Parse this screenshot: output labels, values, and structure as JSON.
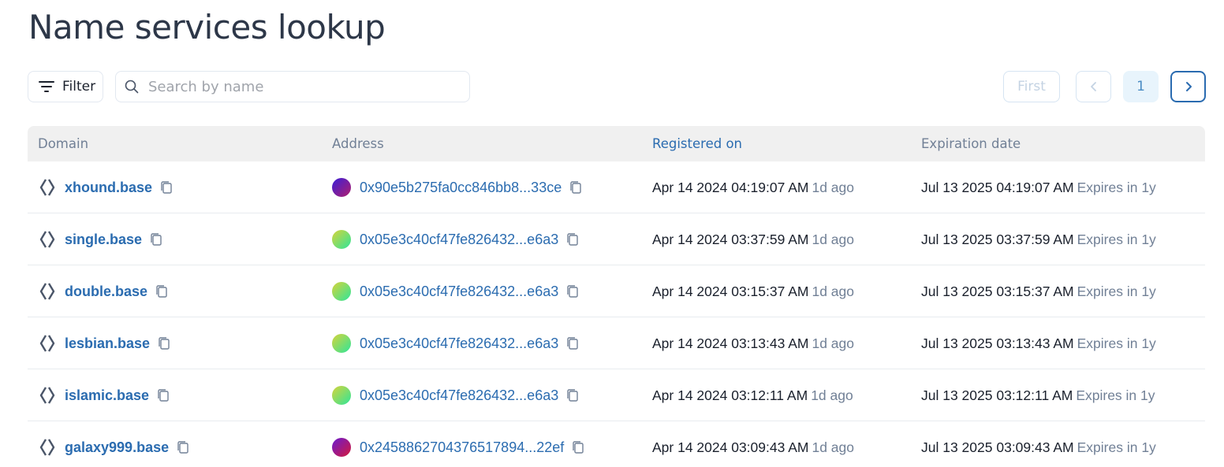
{
  "page": {
    "title": "Name services lookup"
  },
  "toolbar": {
    "filter_label": "Filter",
    "search_placeholder": "Search by name"
  },
  "pagination": {
    "first_label": "First",
    "current_page": "1"
  },
  "table": {
    "headers": {
      "domain": "Domain",
      "address": "Address",
      "registered": "Registered on",
      "expiration": "Expiration date"
    },
    "rows": [
      {
        "domain": "xhound.base",
        "address": "0x90e5b275fa0cc846bb8...33ce",
        "avatar_colors": [
          "#3b1fd8",
          "#b01f6e"
        ],
        "registered": "Apr 14 2024 04:19:07 AM",
        "registered_ago": "1d ago",
        "expires": "Jul 13 2025 04:19:07 AM",
        "expires_in": "Expires in 1y"
      },
      {
        "domain": "single.base",
        "address": "0x05e3c40cf47fe826432...e6a3",
        "avatar_colors": [
          "#d6d43a",
          "#2ee59a"
        ],
        "registered": "Apr 14 2024 03:37:59 AM",
        "registered_ago": "1d ago",
        "expires": "Jul 13 2025 03:37:59 AM",
        "expires_in": "Expires in 1y"
      },
      {
        "domain": "double.base",
        "address": "0x05e3c40cf47fe826432...e6a3",
        "avatar_colors": [
          "#d6d43a",
          "#2ee59a"
        ],
        "registered": "Apr 14 2024 03:15:37 AM",
        "registered_ago": "1d ago",
        "expires": "Jul 13 2025 03:15:37 AM",
        "expires_in": "Expires in 1y"
      },
      {
        "domain": "lesbian.base",
        "address": "0x05e3c40cf47fe826432...e6a3",
        "avatar_colors": [
          "#d6d43a",
          "#2ee59a"
        ],
        "registered": "Apr 14 2024 03:13:43 AM",
        "registered_ago": "1d ago",
        "expires": "Jul 13 2025 03:13:43 AM",
        "expires_in": "Expires in 1y"
      },
      {
        "domain": "islamic.base",
        "address": "0x05e3c40cf47fe826432...e6a3",
        "avatar_colors": [
          "#d6d43a",
          "#2ee59a"
        ],
        "registered": "Apr 14 2024 03:12:11 AM",
        "registered_ago": "1d ago",
        "expires": "Jul 13 2025 03:12:11 AM",
        "expires_in": "Expires in 1y"
      },
      {
        "domain": "galaxy999.base",
        "address": "0x2458862704376517894...22ef",
        "avatar_colors": [
          "#6a1bd1",
          "#d41a3c"
        ],
        "registered": "Apr 14 2024 03:09:43 AM",
        "registered_ago": "1d ago",
        "expires": "Jul 13 2025 03:09:43 AM",
        "expires_in": "Expires in 1y"
      }
    ]
  },
  "colors": {
    "link": "#2b6cb0",
    "muted": "#718096",
    "header_bg": "#f0f0f0"
  },
  "icons": {
    "domain": "ens-icon",
    "copy": "copy-icon",
    "filter": "filter-icon",
    "search": "search-icon"
  }
}
